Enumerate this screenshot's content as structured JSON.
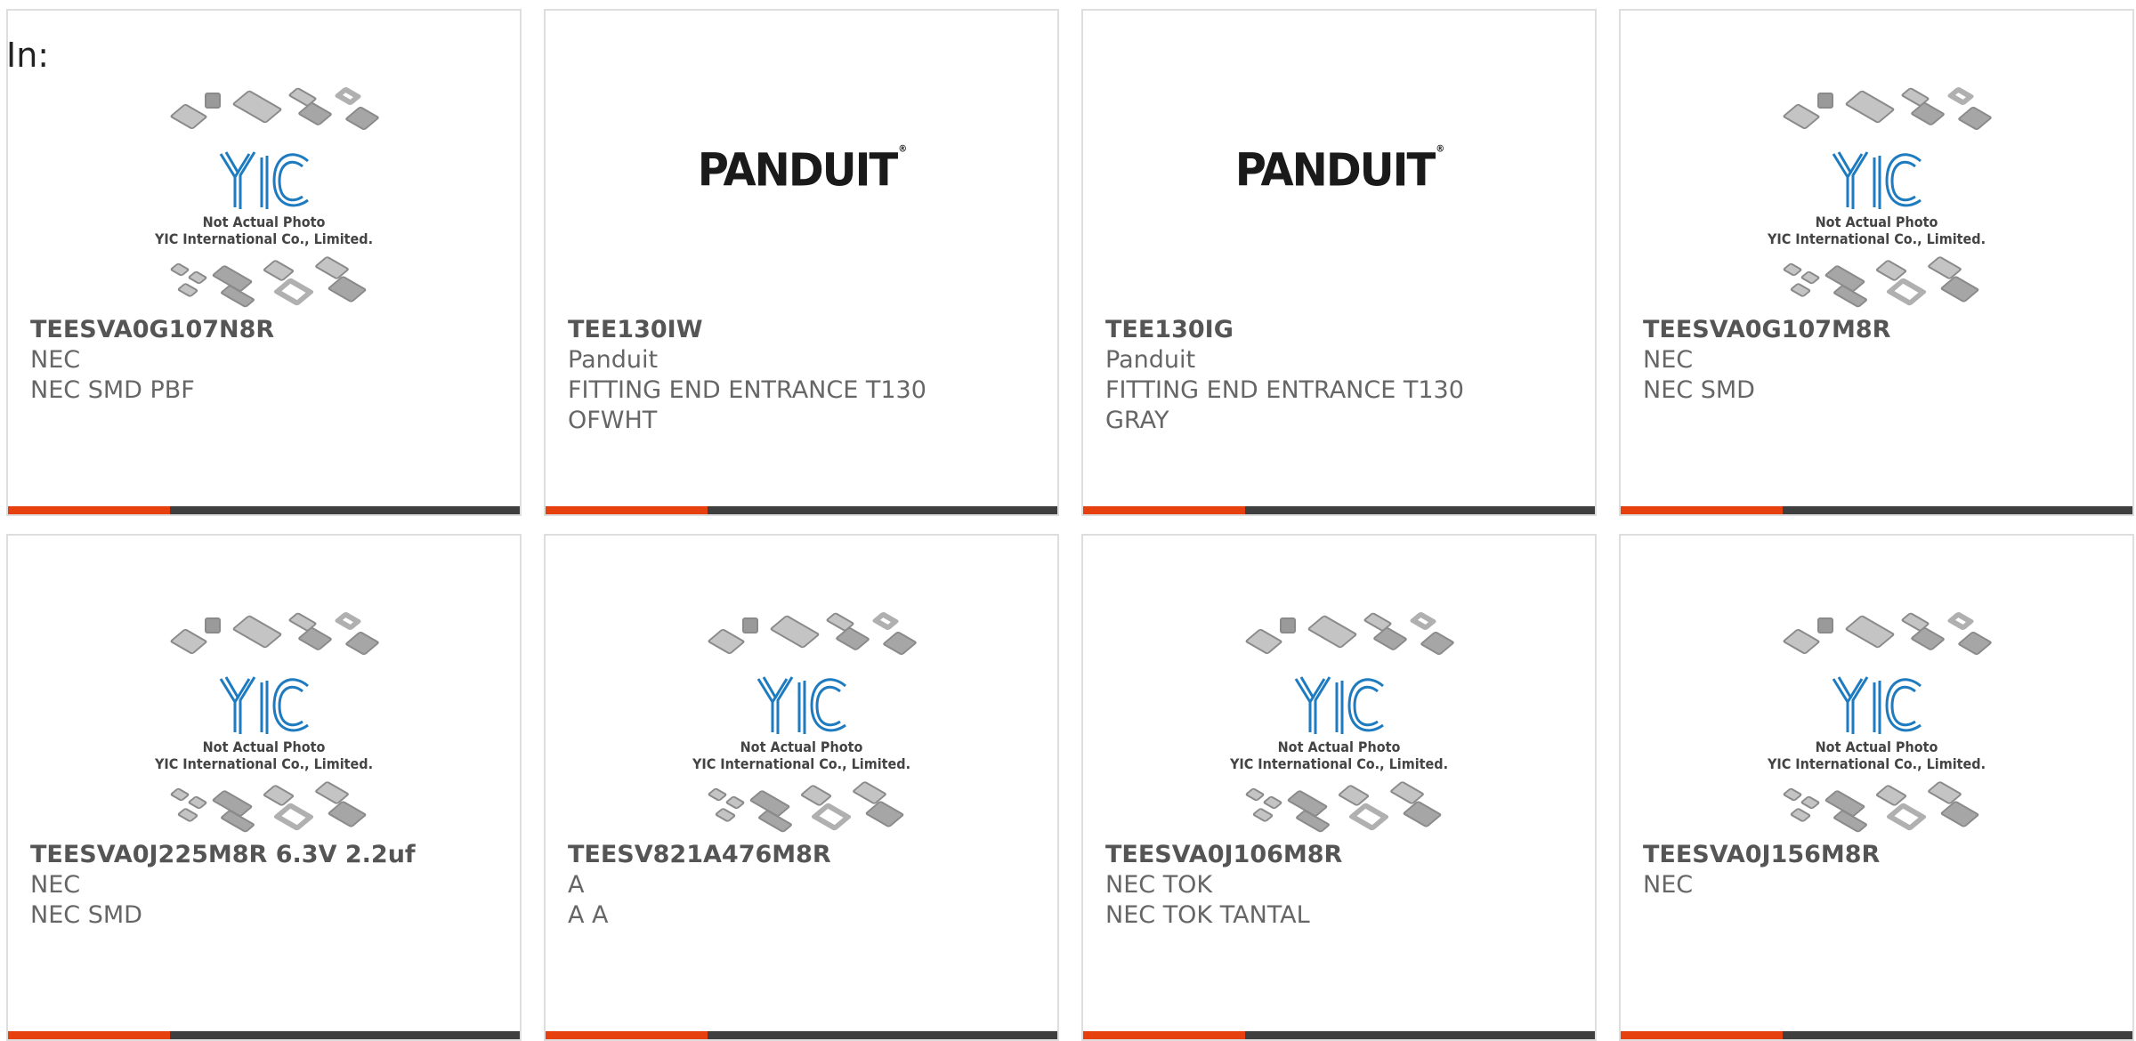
{
  "header": {
    "label": "In:"
  },
  "placeholder": {
    "brand": "YIC",
    "line1": "Not Actual Photo",
    "line2": "YIC International Co., Limited."
  },
  "colors": {
    "accent": "#e5400d",
    "bar": "#3f3f3f",
    "logo_blue": "#1e7bc0"
  },
  "products": [
    {
      "part": "TEESVA0G107N8R",
      "lines": [
        "NEC",
        "NEC SMD PBF"
      ],
      "image": "yic-placeholder"
    },
    {
      "part": "TEE130IW",
      "lines": [
        "Panduit",
        "FITTING END ENTRANCE T130",
        "OFWHT"
      ],
      "image": "panduit-logo",
      "logo_text": "PANDUIT"
    },
    {
      "part": "TEE130IG",
      "lines": [
        "Panduit",
        "FITTING END ENTRANCE T130",
        "GRAY"
      ],
      "image": "panduit-logo",
      "logo_text": "PANDUIT"
    },
    {
      "part": "TEESVA0G107M8R",
      "lines": [
        "NEC",
        "NEC SMD"
      ],
      "image": "yic-placeholder"
    },
    {
      "part": "TEESVA0J225M8R 6.3V 2.2uf",
      "lines": [
        "NEC",
        "NEC SMD"
      ],
      "image": "yic-placeholder"
    },
    {
      "part": "TEESV821A476M8R",
      "lines": [
        "A",
        "A A"
      ],
      "image": "yic-placeholder"
    },
    {
      "part": "TEESVA0J106M8R",
      "lines": [
        "NEC TOK",
        "NEC TOK TANTAL"
      ],
      "image": "yic-placeholder"
    },
    {
      "part": "TEESVA0J156M8R",
      "lines": [
        "NEC"
      ],
      "image": "yic-placeholder"
    }
  ]
}
